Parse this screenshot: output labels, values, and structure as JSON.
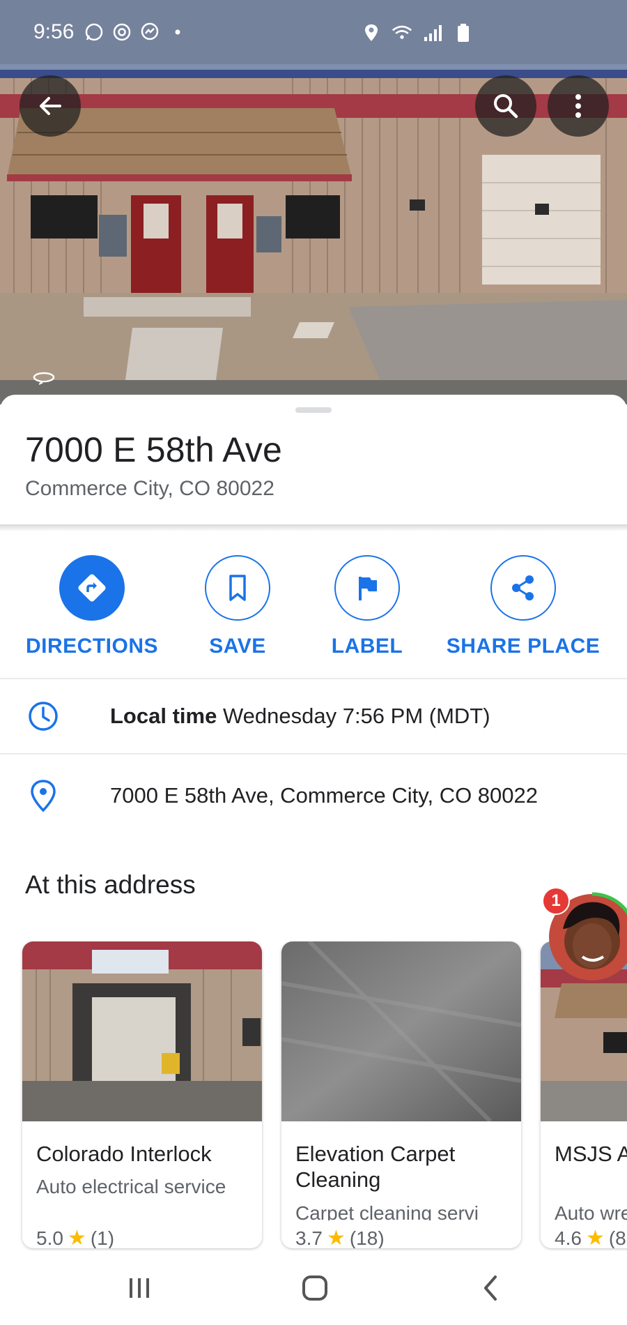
{
  "status_bar": {
    "time": "9:56",
    "left_icons": [
      "whatsapp-icon",
      "threads-icon",
      "messenger-icon",
      "dot-icon"
    ],
    "right_icons": [
      "location-icon",
      "wifi-icon",
      "signal-icon",
      "battery-icon"
    ]
  },
  "top_controls": {
    "back_icon": "arrow-left-icon",
    "search_icon": "search-icon",
    "more_icon": "more-vertical-icon"
  },
  "place": {
    "title": "7000 E 58th Ave",
    "subtitle": "Commerce City, CO 80022"
  },
  "actions": [
    {
      "label": "DIRECTIONS",
      "icon": "directions-icon"
    },
    {
      "label": "SAVE",
      "icon": "bookmark-icon"
    },
    {
      "label": "LABEL",
      "icon": "flag-icon"
    },
    {
      "label": "SHARE PLACE",
      "icon": "share-icon"
    }
  ],
  "local_time": {
    "label": "Local time",
    "value": "Wednesday 7:56 PM (MDT)"
  },
  "address": {
    "full": "7000 E 58th Ave, Commerce City, CO 80022"
  },
  "at_this_address": {
    "title": "At this address",
    "cards": [
      {
        "name": "Colorado Interlock",
        "category": "Auto electrical service",
        "rating": "5.0",
        "reviews": "(1)"
      },
      {
        "name": "Elevation Carpet Cleaning",
        "category": "Carpet cleaning servi",
        "rating": "3.7",
        "reviews": "(18)"
      },
      {
        "name": "MSJS A & Scrap",
        "category": "Auto wre",
        "rating": "4.6",
        "reviews": "(8"
      }
    ]
  },
  "chat_head": {
    "badge_count": "1"
  },
  "colors": {
    "accent": "#1a73e8",
    "star": "#fbbc04",
    "text_primary": "#202124",
    "text_secondary": "#5f6368",
    "badge": "#e53935"
  }
}
